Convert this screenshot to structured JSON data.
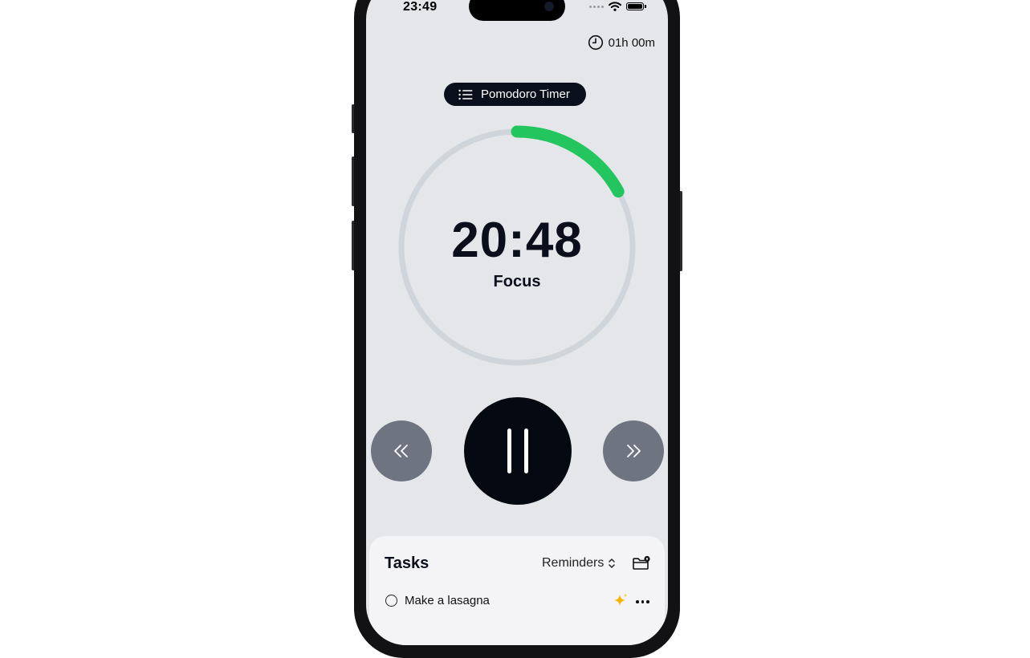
{
  "status_bar": {
    "time": "23:49",
    "icons": [
      "cellular-dots-icon",
      "wifi-icon",
      "battery-icon"
    ]
  },
  "session": {
    "icon": "clock-icon",
    "label": "01h 00m"
  },
  "mode_pill": {
    "icon": "list-icon",
    "label": "Pomodoro Timer"
  },
  "timer": {
    "time": "20:48",
    "phase": "Focus",
    "progress": 0.17,
    "progress_color": "#22c55e",
    "track_color": "#cfd5da"
  },
  "controls": {
    "rewind_icon": "chevrons-left-icon",
    "pause_icon": "pause-icon",
    "forward_icon": "chevrons-right-icon"
  },
  "tasks": {
    "title": "Tasks",
    "list_selector": "Reminders",
    "items": [
      {
        "label": "Make a lasagna",
        "done": false
      }
    ]
  },
  "colors": {
    "background": "#e5e6e9",
    "dark": "#0a0f1c",
    "side_buttons": "#6f7481",
    "accent": "#22c55e",
    "sparkle": "#f4b400"
  }
}
